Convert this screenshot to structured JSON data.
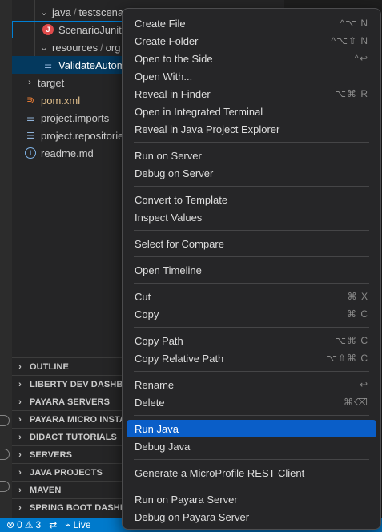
{
  "explorer": {
    "rows": [
      {
        "label": "java",
        "sub": "testscenarios"
      },
      {
        "label": "ScenarioJunitTest"
      },
      {
        "label": "resources",
        "sub": "org"
      },
      {
        "label": "ValidateAutomation"
      },
      {
        "label": "target"
      },
      {
        "label": "pom.xml"
      },
      {
        "label": "project.imports"
      },
      {
        "label": "project.repositories"
      },
      {
        "label": "readme.md"
      }
    ],
    "separator": "/"
  },
  "panels": [
    "OUTLINE",
    "LIBERTY DEV DASHBOARD",
    "PAYARA SERVERS",
    "PAYARA MICRO INSTANCES",
    "DIDACT TUTORIALS",
    "SERVERS",
    "JAVA PROJECTS",
    "MAVEN",
    "SPRING BOOT DASHBOARD"
  ],
  "status_bar": {
    "errors": "0",
    "warnings": "3",
    "live": "Live"
  },
  "context_menu": {
    "items": [
      {
        "label": "Create File",
        "shortcut": "^⌥ N"
      },
      {
        "label": "Create Folder",
        "shortcut": "^⌥⇧ N"
      },
      {
        "label": "Open to the Side",
        "shortcut": "^↩"
      },
      {
        "label": "Open With...",
        "shortcut": ""
      },
      {
        "label": "Reveal in Finder",
        "shortcut": "⌥⌘ R"
      },
      {
        "label": "Open in Integrated Terminal",
        "shortcut": ""
      },
      {
        "label": "Reveal in Java Project Explorer",
        "shortcut": ""
      },
      {
        "label": "Run on Server",
        "shortcut": ""
      },
      {
        "label": "Debug on Server",
        "shortcut": ""
      },
      {
        "label": "Convert to Template",
        "shortcut": ""
      },
      {
        "label": "Inspect Values",
        "shortcut": ""
      },
      {
        "label": "Select for Compare",
        "shortcut": ""
      },
      {
        "label": "Open Timeline",
        "shortcut": ""
      },
      {
        "label": "Cut",
        "shortcut": "⌘ X"
      },
      {
        "label": "Copy",
        "shortcut": "⌘ C"
      },
      {
        "label": "Copy Path",
        "shortcut": "⌥⌘ C"
      },
      {
        "label": "Copy Relative Path",
        "shortcut": "⌥⇧⌘ C"
      },
      {
        "label": "Rename",
        "shortcut": "↩"
      },
      {
        "label": "Delete",
        "shortcut": "⌘⌫"
      },
      {
        "label": "Run Java",
        "shortcut": ""
      },
      {
        "label": "Debug Java",
        "shortcut": ""
      },
      {
        "label": "Generate a MicroProfile REST Client",
        "shortcut": ""
      },
      {
        "label": "Run on Payara Server",
        "shortcut": ""
      },
      {
        "label": "Debug on Payara Server",
        "shortcut": ""
      }
    ],
    "highlighted": "Run Java"
  },
  "colors": {
    "accent": "#007acc",
    "menu_highlight": "#0a5ec8",
    "selection": "#04395e"
  }
}
